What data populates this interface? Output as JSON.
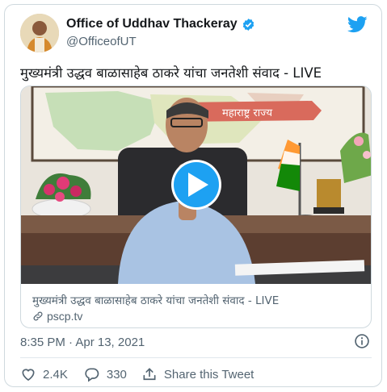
{
  "tweet": {
    "author_name": "Office of Uddhav Thackeray",
    "handle": "@OfficeofUT",
    "text": "मुख्यमंत्री उद्धव बाळासाहेब ठाकरे यांचा जनतेशी संवाद - LIVE",
    "timestamp": "8:35 PM · Apr 13, 2021"
  },
  "media": {
    "banner_text": "महाराष्ट्र राज्य",
    "card_title": "मुख्यमंत्री उद्धव बाळासाहेब ठाकरे यांचा जनतेशी संवाद - LIVE",
    "card_domain": "pscp.tv"
  },
  "actions": {
    "likes": "2.4K",
    "replies": "330",
    "share_label": "Share this Tweet"
  },
  "colors": {
    "brand_blue": "#1da1f2",
    "text_primary": "#14171a",
    "text_secondary": "#536471",
    "border": "#cfd9de"
  },
  "icons": [
    "verified-badge-icon",
    "twitter-bird-icon",
    "play-icon",
    "link-icon",
    "info-icon",
    "heart-icon",
    "reply-icon",
    "share-icon"
  ]
}
